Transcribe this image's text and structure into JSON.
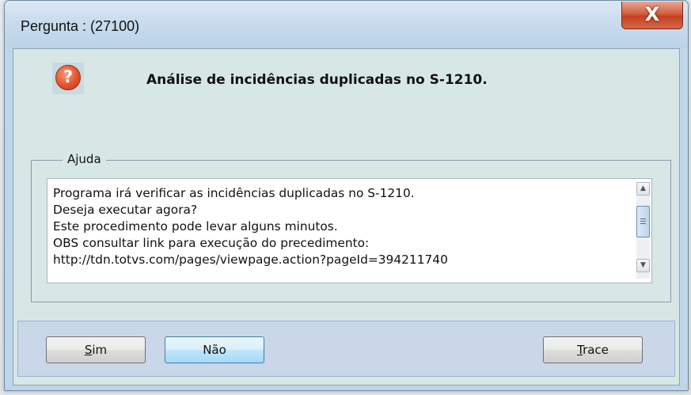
{
  "window": {
    "title": "Pergunta : (27100)",
    "close_glyph": "X"
  },
  "dialog": {
    "icon": "question-icon",
    "icon_glyph": "?",
    "heading": "Análise de incidências duplicadas no S-1210.",
    "group_label": "Ajuda",
    "help_lines": [
      "Programa irá verificar as incidências duplicadas no S-1210.",
      "Deseja executar agora?",
      "Este procedimento pode levar alguns minutos.",
      "OBS consultar link para execução do precedimento:",
      "http://tdn.totvs.com/pages/viewpage.action?pageId=394211740"
    ]
  },
  "buttons": {
    "yes_mnemonic": "S",
    "yes_rest": "im",
    "no_label": "Não",
    "trace_mnemonic": "T",
    "trace_rest": "race"
  },
  "colors": {
    "close_button": "#c4401f",
    "default_button_border": "#3c7fb1",
    "client_bg": "#d7e7e6"
  }
}
